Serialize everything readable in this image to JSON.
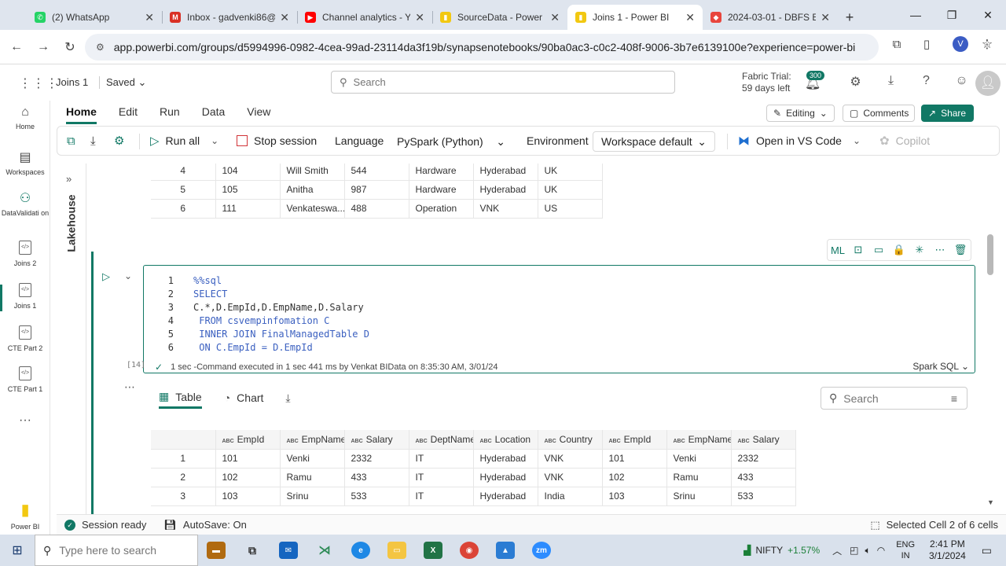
{
  "browser": {
    "tabs": [
      {
        "label": "(2) WhatsApp",
        "color": "#25d366",
        "glyph": "✆"
      },
      {
        "label": "Inbox - gadvenki86@",
        "color": "#d93025",
        "glyph": "M"
      },
      {
        "label": "Channel analytics - Y",
        "color": "#ff0000",
        "glyph": "▶"
      },
      {
        "label": "SourceData - Power B",
        "color": "#f2c811",
        "glyph": "▮"
      },
      {
        "label": "Joins 1 - Power BI",
        "color": "#f2c811",
        "glyph": "▮"
      },
      {
        "label": "2024-03-01 - DBFS E",
        "color": "#e8453c",
        "glyph": "◆"
      }
    ],
    "url": "app.powerbi.com/groups/d5994996-0982-4cea-99ad-23114da3f19b/synapsenotebooks/90ba0ac3-c0c2-408f-9006-3b7e6139100e?experience=power-bi",
    "profile_initial": "V"
  },
  "app": {
    "notebook_name": "Joins 1",
    "saved": "Saved",
    "search_placeholder": "Search",
    "trial_line1": "Fabric Trial:",
    "trial_line2": "59 days left",
    "notif_count": "300",
    "editing": "Editing",
    "comments": "Comments",
    "share": "Share"
  },
  "leftnav": [
    {
      "label": "Home",
      "icon": "home-icon"
    },
    {
      "label": "Workspaces",
      "icon": "workspaces-icon"
    },
    {
      "label": "DataValidati on",
      "icon": "dataflow-icon"
    },
    {
      "label": "Joins 2",
      "icon": "notebook-icon"
    },
    {
      "label": "Joins 1",
      "icon": "notebook-icon"
    },
    {
      "label": "CTE Part 2",
      "icon": "notebook-icon"
    },
    {
      "label": "CTE Part 1",
      "icon": "notebook-icon"
    },
    {
      "label": "...",
      "icon": "more-icon"
    },
    {
      "label": "Power BI",
      "icon": "powerbi-icon"
    }
  ],
  "ribbon": {
    "tabs": [
      "Home",
      "Edit",
      "Run",
      "Data",
      "View"
    ],
    "run_all": "Run all",
    "stop_session": "Stop session",
    "language_label": "Language",
    "language_value": "PySpark (Python)",
    "environment_label": "Environment",
    "environment_value": "Workspace default",
    "open_vscode": "Open in VS Code",
    "copilot": "Copilot"
  },
  "lakehouse_label": "Lakehouse",
  "prev_table": {
    "rows": [
      [
        "4",
        "104",
        "Will Smith",
        "544",
        "Hardware",
        "Hyderabad",
        "UK"
      ],
      [
        "5",
        "105",
        "Anitha",
        "987",
        "Hardware",
        "Hyderabad",
        "UK"
      ],
      [
        "6",
        "111",
        "Venkateswa...",
        "488",
        "Operation",
        "VNK",
        "US"
      ]
    ]
  },
  "cell": {
    "lines": [
      {
        "n": "1",
        "t": "%%sql"
      },
      {
        "n": "2",
        "t": "SELECT"
      },
      {
        "n": "3",
        "t": "C.*,D.EmpId,D.EmpName,D.Salary"
      },
      {
        "n": "4",
        "t": " FROM csvempinfomation C"
      },
      {
        "n": "5",
        "t": " INNER JOIN FinalManagedTable D"
      },
      {
        "n": "6",
        "t": " ON C.EmpId = D.EmpId"
      }
    ],
    "exec_count": "[14]",
    "exec_text": "1 sec -Command executed in 1 sec 441 ms by Venkat BIData on 8:35:30 AM, 3/01/24",
    "lang": "Spark SQL",
    "tools": [
      "ML",
      "⊡",
      "▭",
      "🔒",
      "✳",
      "⋯",
      "🗑"
    ]
  },
  "output": {
    "tabs": [
      "Table",
      "Chart"
    ],
    "search_placeholder": "Search",
    "columns": [
      "EmpId",
      "EmpName",
      "Salary",
      "DeptName",
      "Location",
      "Country",
      "EmpId",
      "EmpName",
      "Salary"
    ],
    "rows": [
      [
        "1",
        "101",
        "Venki",
        "2332",
        "IT",
        "Hyderabad",
        "VNK",
        "101",
        "Venki",
        "2332"
      ],
      [
        "2",
        "102",
        "Ramu",
        "433",
        "IT",
        "Hyderabad",
        "VNK",
        "102",
        "Ramu",
        "433"
      ],
      [
        "3",
        "103",
        "Srinu",
        "533",
        "IT",
        "Hyderabad",
        "India",
        "103",
        "Srinu",
        "533"
      ]
    ]
  },
  "status": {
    "session": "Session ready",
    "autosave": "AutoSave: On",
    "selected": "Selected Cell 2 of 6 cells"
  },
  "taskbar": {
    "search_placeholder": "Type here to search",
    "nifty_label": "NIFTY",
    "nifty_change": "+1.57%",
    "lang1": "ENG",
    "lang2": "IN",
    "time": "2:41 PM",
    "date": "3/1/2024"
  }
}
